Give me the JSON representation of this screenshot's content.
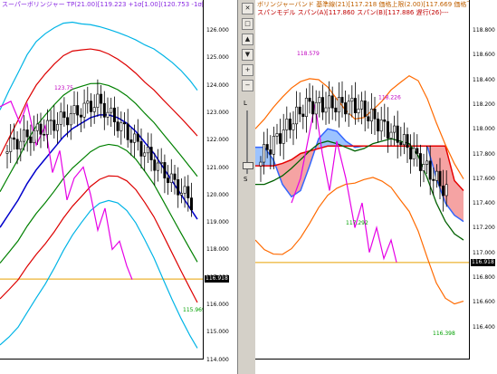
{
  "left_chart": {
    "header": "スーパーボリンジャー TP(21.00)[119.223 +1σ[1.00](120.753 -1σ[1.00](117.694 +2σ[2.00](122.283 -2σ[2.0",
    "y_ticks": [
      "126.000",
      "125.000",
      "124.000",
      "123.000",
      "122.000",
      "121.000",
      "120.000",
      "119.000",
      "118.000",
      "117.000",
      "116.000",
      "115.000",
      "114.000"
    ],
    "current_price": "116.918",
    "high_label": "123.75",
    "low_label": "115.969",
    "colors": {
      "plus2": "#dd0000",
      "minus2": "#dd0000",
      "plus1": "#008000",
      "minus1": "#008000",
      "mid": "#0000cc",
      "plus3": "#00b4e6",
      "minus3": "#00b4e6",
      "chikou": "#e600e6",
      "price_line": "#e6a000"
    }
  },
  "right_chart": {
    "header1": "ボリンジャーバンド 基準線(21)[117.218 価格上限(2.00)[117.669 価格下限(1.00)[116.448",
    "header2": "スパンモデル スパン(A)[117.860 スパン(B)[117.886 遅行(26)---",
    "y_ticks": [
      "118.800",
      "118.600",
      "118.400",
      "118.200",
      "118.000",
      "117.800",
      "117.600",
      "117.400",
      "117.200",
      "117.000",
      "116.800",
      "116.600",
      "116.400"
    ],
    "current_price": "116.918",
    "labels": {
      "high1": "118.579",
      "high2": "118.226",
      "low1": "117.292",
      "low2": "116.398"
    },
    "colors": {
      "band": "#ff6a00",
      "mid": "#006000",
      "span_a": "#3366ff",
      "span_b": "#e60000",
      "chikou": "#e600e6",
      "bear_fill": "#f5a3a3",
      "bull_fill": "#9cc3ff"
    }
  },
  "middle_strip": {
    "slider_label_top": "L",
    "slider_label_bottom": "S"
  }
}
